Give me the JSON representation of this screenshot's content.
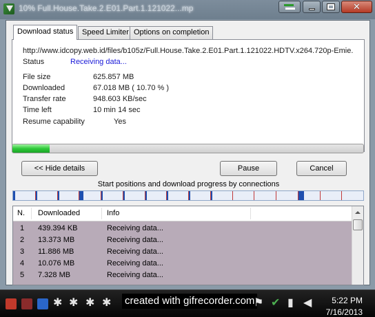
{
  "window": {
    "title": "10% Full.House.Take.2.E01.Part.1.121022...mp",
    "controls": [
      "arrows-icon",
      "minimize-icon",
      "maximize-icon",
      "close-icon"
    ]
  },
  "tabs": [
    {
      "label": "Download status",
      "active": true
    },
    {
      "label": "Speed Limiter",
      "active": false
    },
    {
      "label": "Options on completion",
      "active": false
    }
  ],
  "status": {
    "url": "http://www.idcopy.web.id/files/b105z/Full.House.Take.2.E01.Part.1.121022.HDTV.x264.720p-Emie.",
    "status_label": "Status",
    "status_value": "Receiving data...",
    "rows": [
      {
        "label": "File size",
        "value": "625.857  MB"
      },
      {
        "label": "Downloaded",
        "value": "67.018  MB  ( 10.70 % )"
      },
      {
        "label": "Transfer rate",
        "value": "948.603  KB/sec"
      },
      {
        "label": "Time left",
        "value": "10 min 14 sec"
      },
      {
        "label": "Resume capability",
        "value": "Yes"
      }
    ]
  },
  "progress": {
    "fraction": 0.107
  },
  "buttons": {
    "hide_details": "<< Hide details",
    "pause": "Pause",
    "cancel": "Cancel"
  },
  "connections": {
    "caption": "Start positions and download progress by connections",
    "count": 16,
    "progress_fractions": [
      0.1,
      0.08,
      0.12,
      0.2,
      0.1,
      0.11,
      0.09,
      0.08,
      0.1,
      0.05,
      0.0,
      0.0,
      0.0,
      0.3,
      0.0,
      0.0
    ],
    "fill_color": "#1e4fb0",
    "bg_color": "#e9eef8",
    "divider_color": "#c13838"
  },
  "table": {
    "headers": [
      "N.",
      "Downloaded",
      "Info"
    ],
    "rows": [
      {
        "n": "1",
        "downloaded": "439.394  KB",
        "info": "Receiving data..."
      },
      {
        "n": "2",
        "downloaded": "13.373  MB",
        "info": "Receiving data..."
      },
      {
        "n": "3",
        "downloaded": "11.886  MB",
        "info": "Receiving data..."
      },
      {
        "n": "4",
        "downloaded": "10.076  MB",
        "info": "Receiving data..."
      },
      {
        "n": "5",
        "downloaded": "7.328  MB",
        "info": "Receiving data..."
      }
    ]
  },
  "taskbar": {
    "watermark": "created with gifrecorder.com",
    "time": "5:22 PM",
    "date": "7/16/2013"
  }
}
